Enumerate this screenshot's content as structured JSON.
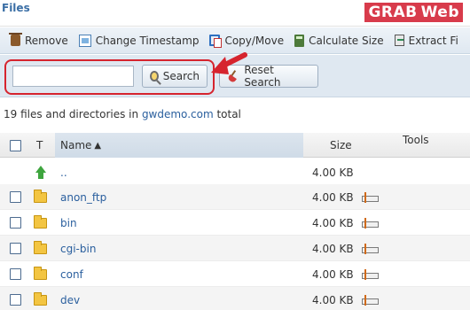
{
  "window": {
    "title": "Files"
  },
  "watermark": {
    "part1": "GRAB",
    "part2": "Web"
  },
  "toolbar": {
    "items": [
      {
        "label": "Remove",
        "icon": "trash-icon"
      },
      {
        "label": "Change Timestamp",
        "icon": "timestamp-icon"
      },
      {
        "label": "Copy/Move",
        "icon": "copy-move-icon"
      },
      {
        "label": "Calculate Size",
        "icon": "calculator-icon"
      },
      {
        "label": "Extract Fi",
        "icon": "extract-icon"
      }
    ]
  },
  "search": {
    "input_value": "",
    "search_label": "Search",
    "reset_label": "Reset Search"
  },
  "summary": {
    "prefix": "19 files and directories in ",
    "domain": "gwdemo.com",
    "suffix": " total"
  },
  "table": {
    "columns": {
      "type": "T",
      "name": "Name",
      "size": "Size",
      "tools": "Tools"
    },
    "sort_indicator": "▲",
    "rows": [
      {
        "name": "..",
        "size": "4.00 KB",
        "type": "parent"
      },
      {
        "name": "anon_ftp",
        "size": "4.00 KB",
        "type": "folder"
      },
      {
        "name": "bin",
        "size": "4.00 KB",
        "type": "folder"
      },
      {
        "name": "cgi-bin",
        "size": "4.00 KB",
        "type": "folder"
      },
      {
        "name": "conf",
        "size": "4.00 KB",
        "type": "folder"
      },
      {
        "name": "dev",
        "size": "4.00 KB",
        "type": "folder"
      }
    ]
  },
  "colors": {
    "highlight": "#d6242e",
    "link": "#2a5f9e",
    "toolbar_bg": "#dfe8f1"
  }
}
